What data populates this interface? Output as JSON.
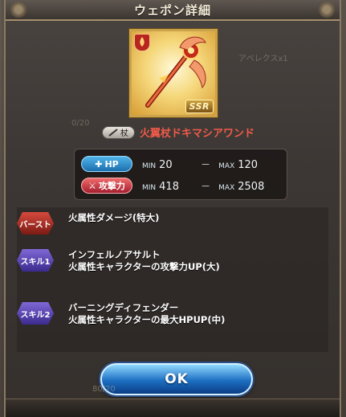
{
  "dialog": {
    "title": "ウェポン詳細",
    "ok_label": "OK"
  },
  "weapon": {
    "name": "火翼杖ドキマシアワンド",
    "type_label": "杖",
    "rarity": "SSR",
    "element_color": "#b8251e"
  },
  "stats": {
    "hp": {
      "label": "HP",
      "min_label": "MIN",
      "min": "20",
      "max_label": "MAX",
      "max": "120",
      "separator": "－"
    },
    "atk": {
      "label": "攻撃力",
      "min_label": "MIN",
      "min": "418",
      "max_label": "MAX",
      "max": "2508",
      "separator": "－"
    }
  },
  "skills": [
    {
      "badge": "バースト",
      "kind": "burst",
      "lines": [
        "火属性ダメージ(特大)"
      ]
    },
    {
      "badge": "スキル1",
      "kind": "skill",
      "lines": [
        "インフェルノアサルト",
        "火属性キャラクターの攻撃力UP(大)"
      ]
    },
    {
      "badge": "スキル2",
      "kind": "skill",
      "lines": [
        "バーニングディフェンダー",
        "火属性キャラクターの最大HPUP(中)"
      ]
    }
  ],
  "background": {
    "ghost_texts": [
      "0/20",
      "80/20",
      "アベレクスx1"
    ]
  },
  "colors": {
    "ok_button": "#1d6fc2",
    "weapon_name": "#f05a4a",
    "hp_badge": "#1c6fae",
    "atk_badge": "#a51e2e"
  }
}
